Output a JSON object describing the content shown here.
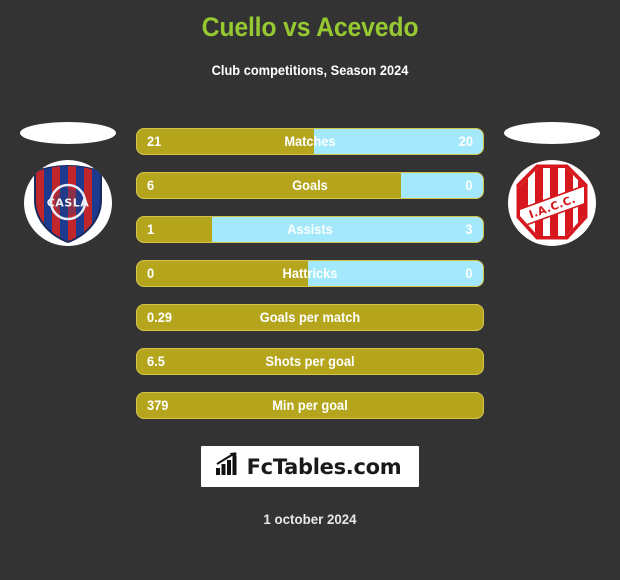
{
  "header": {
    "title": "Cuello vs Acevedo",
    "subtitle": "Club competitions, Season 2024",
    "title_color": "#95c831"
  },
  "theme": {
    "background": "#333333",
    "home_color": "#b5a51c",
    "away_color": "#a3e9fb",
    "border_color": "#d4c54a",
    "text_color": "#ffffff"
  },
  "teams": {
    "home": {
      "crest_name": "san-lorenzo-crest",
      "crest_text": "CASLA",
      "colors": {
        "primary": "#c0272d",
        "secondary": "#1d3a8f"
      }
    },
    "away": {
      "crest_name": "instituto-crest",
      "crest_text": "I.A.C.C.",
      "colors": {
        "primary": "#d6181e",
        "secondary": "#ffffff"
      }
    }
  },
  "stats": [
    {
      "label": "Matches",
      "home": "21",
      "away": "20",
      "home_pct": 51.2,
      "dual": true
    },
    {
      "label": "Goals",
      "home": "6",
      "away": "0",
      "home_pct": 76.4,
      "dual": true
    },
    {
      "label": "Assists",
      "home": "1",
      "away": "3",
      "home_pct": 21.6,
      "dual": true
    },
    {
      "label": "Hattricks",
      "home": "0",
      "away": "0",
      "home_pct": 49.3,
      "dual": true
    },
    {
      "label": "Goals per match",
      "home": "0.29",
      "away": "",
      "home_pct": 100,
      "dual": false
    },
    {
      "label": "Shots per goal",
      "home": "6.5",
      "away": "",
      "home_pct": 100,
      "dual": false
    },
    {
      "label": "Min per goal",
      "home": "379",
      "away": "",
      "home_pct": 100,
      "dual": false
    }
  ],
  "footer": {
    "brand": "FcTables.com",
    "brand_icon": "bar-chart-icon",
    "date": "1 october 2024"
  }
}
